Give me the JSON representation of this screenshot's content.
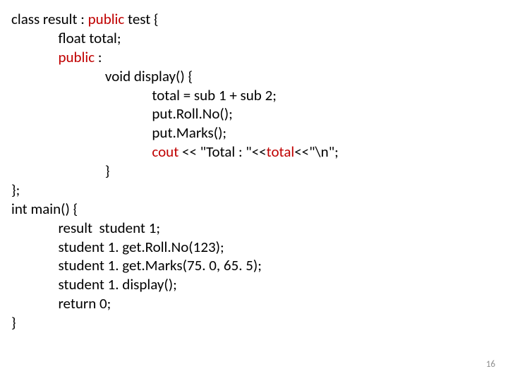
{
  "code": {
    "l1a": "class result : ",
    "l1b": "public",
    "l1c": " test {",
    "l2": "              float total;",
    "l3a": "              ",
    "l3b": "public",
    "l3c": " :",
    "l4": "                            void display() {",
    "l5": "                                          total = sub 1 + sub 2;",
    "l6": "                                          put.Roll.No();",
    "l7": "                                          put.Marks();",
    "l8a": "                                          ",
    "l8b": "cout",
    "l8c": " << \"Total : \"<<",
    "l8d": "total",
    "l8e": "<<\"\\n\";",
    "l9": "                            }",
    "l10": "};",
    "l11": "int main() {",
    "l12": "              result  student 1;",
    "l13": "              student 1. get.Roll.No(123);",
    "l14": "              student 1. get.Marks(75. 0, 65. 5);",
    "l15": "              student 1. display();",
    "l16": "              return 0;",
    "l17": "}"
  },
  "pagenum": "16"
}
